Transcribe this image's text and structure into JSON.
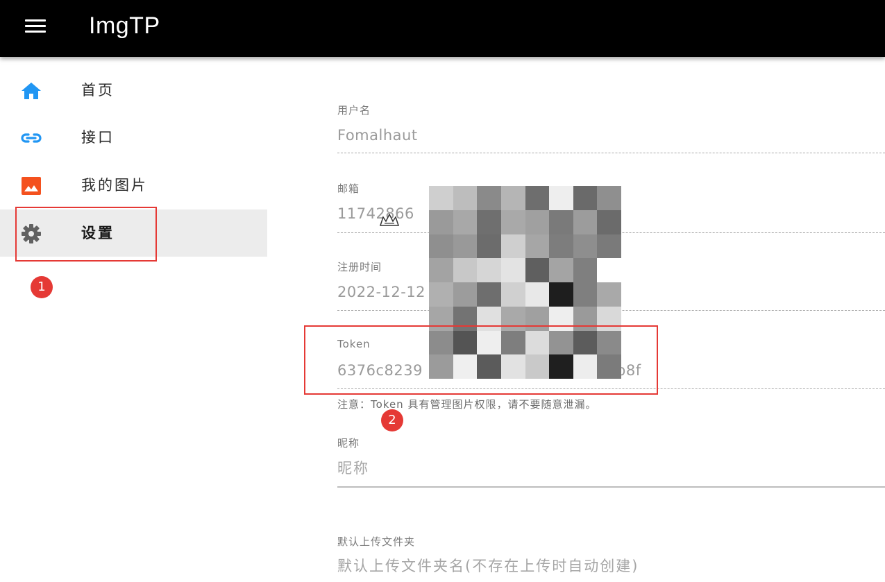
{
  "app": {
    "title": "ImgTP"
  },
  "icons": {
    "menu": "menu-icon",
    "home": "home-icon",
    "link": "link-icon",
    "image": "image-icon",
    "settings": "gear-icon"
  },
  "colors": {
    "appbar": "#000000",
    "accent_blue": "#2196f3",
    "accent_orange": "#f4511e",
    "annotation_red": "#e53935"
  },
  "sidebar": {
    "items": [
      {
        "label": "首页",
        "icon": "home-icon",
        "active": false
      },
      {
        "label": "接口",
        "icon": "link-icon",
        "active": false
      },
      {
        "label": "我的图片",
        "icon": "image-icon",
        "active": false
      },
      {
        "label": "设置",
        "icon": "gear-icon",
        "active": true
      }
    ]
  },
  "annotations": {
    "step1": "1",
    "step2": "2"
  },
  "settings": {
    "username": {
      "label": "用户名",
      "value": "Fomalhaut"
    },
    "email": {
      "label": "邮箱",
      "value": "11742866"
    },
    "registered": {
      "label": "注册时间",
      "value": "2022-12-12"
    },
    "token": {
      "label": "Token",
      "value_start": "6376c8239",
      "value_end": "b8f"
    },
    "token_hint": "注意：Token 具有管理图片权限，请不要随意泄漏。",
    "nickname": {
      "label": "昵称",
      "placeholder": "昵称"
    },
    "default_folder": {
      "label": "默认上传文件夹",
      "placeholder": "默认上传文件夹名(不存在上传时自动创建)"
    }
  }
}
